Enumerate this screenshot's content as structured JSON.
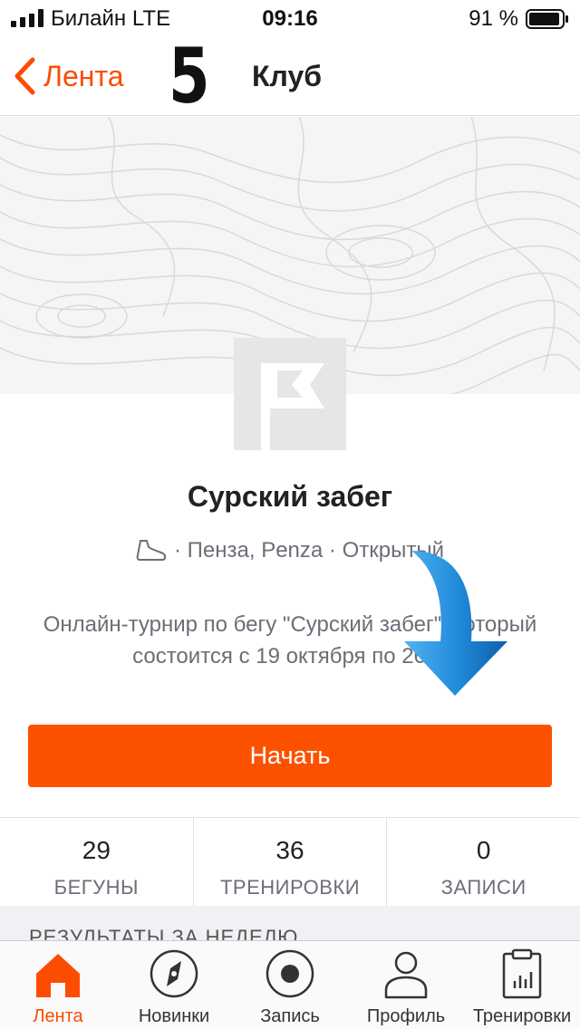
{
  "status_bar": {
    "carrier": "Билайн  LTE",
    "time": "09:16",
    "battery": "91 %"
  },
  "nav": {
    "back_label": "Лента",
    "step_number": "5",
    "title": "Клуб"
  },
  "club": {
    "name": "Сурский забег",
    "meta": "· Пенза, Penza · Открытый",
    "description": "Онлайн-турнир по бегу \"Сурский забег\", который состоится с 19 октября по 26…",
    "start_label": "Начать"
  },
  "stats": [
    {
      "value": "29",
      "label": "БЕГУНЫ"
    },
    {
      "value": "36",
      "label": "ТРЕНИРОВКИ"
    },
    {
      "value": "0",
      "label": "ЗАПИСИ"
    }
  ],
  "section": {
    "title": "РЕЗУЛЬТАТЫ ЗА НЕДЕЛЮ"
  },
  "tabs": [
    {
      "label": "Лента",
      "icon": "home-icon",
      "active": true
    },
    {
      "label": "Новинки",
      "icon": "compass-icon",
      "active": false
    },
    {
      "label": "Запись",
      "icon": "record-icon",
      "active": false
    },
    {
      "label": "Профиль",
      "icon": "profile-icon",
      "active": false
    },
    {
      "label": "Тренировки",
      "icon": "clipboard-icon",
      "active": false
    }
  ],
  "colors": {
    "accent": "#fc4c02",
    "button": "#fc5200",
    "annotation_arrow": "#1e88d8"
  }
}
